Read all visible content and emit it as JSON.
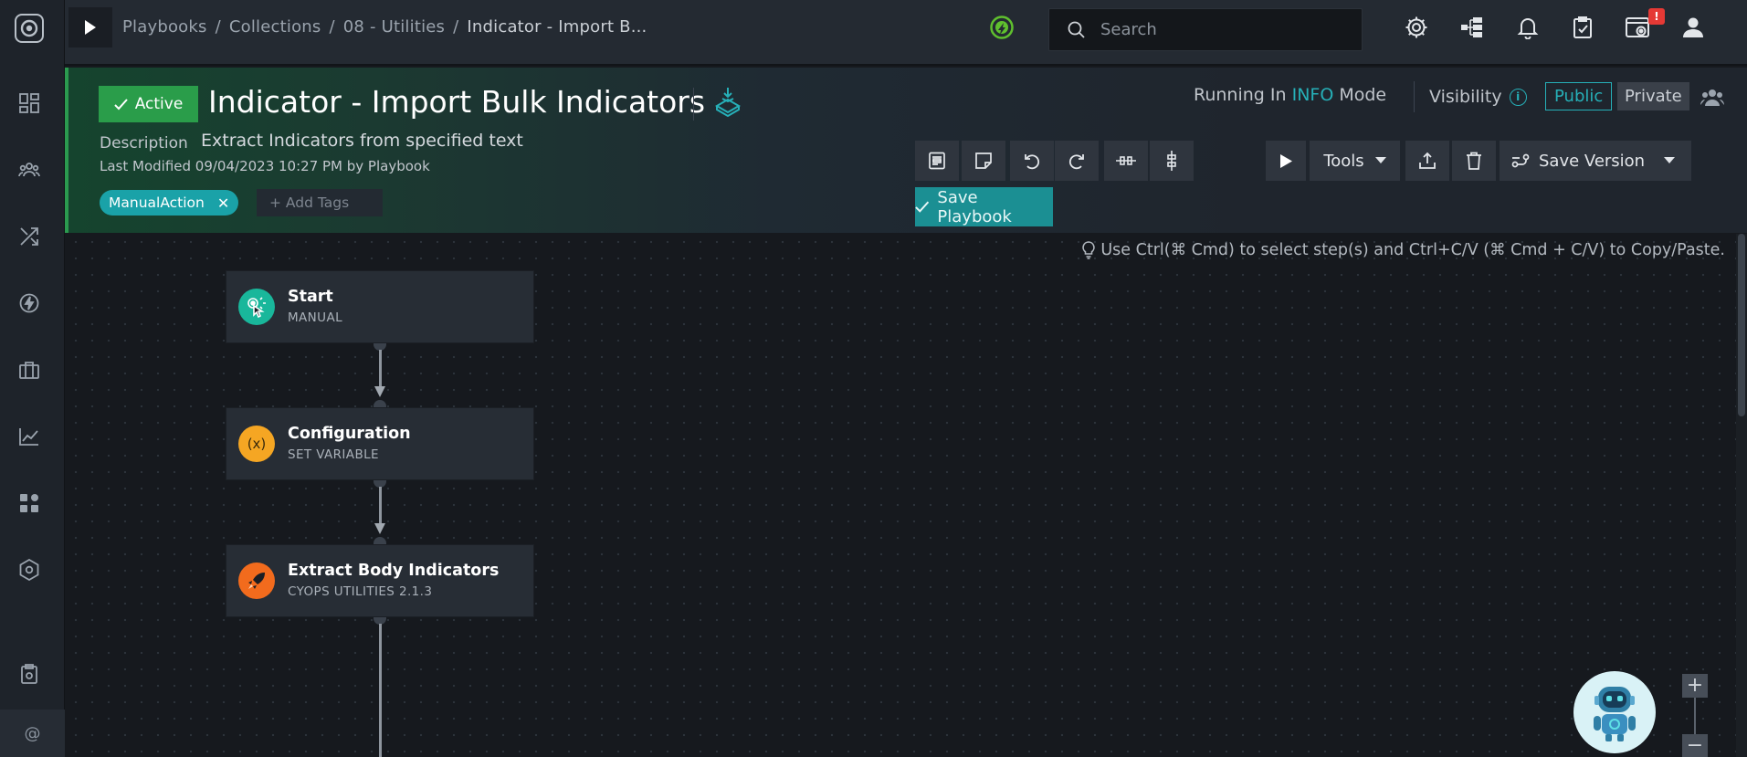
{
  "nav": {
    "breadcrumb": [
      "Playbooks",
      "Collections",
      "08 - Utilities",
      "Indicator - Import B..."
    ],
    "separator": "/"
  },
  "search": {
    "placeholder": "Search"
  },
  "notifications": {
    "badge": "!"
  },
  "sidebar": {
    "items": [
      "dashboard-icon",
      "team-icon",
      "workflow-icon",
      "lightning-icon",
      "briefcase-icon",
      "analytics-icon",
      "apps-icon",
      "hexagon-icon",
      "clipboard-icon"
    ],
    "bottom_label": "@"
  },
  "playbook": {
    "status": "Active",
    "title": "Indicator - Import Bulk Indicators",
    "description_label": "Description",
    "description": "Extract Indicators from specified text",
    "last_modified": "Last Modified 09/04/2023 10:27 PM by Playbook",
    "tags": [
      "ManualAction"
    ],
    "add_tags_placeholder": "+ Add Tags",
    "running_prefix": "Running In",
    "running_mode": "INFO",
    "running_suffix": "Mode",
    "visibility_label": "Visibility",
    "visibility_options": [
      "Public",
      "Private"
    ],
    "visibility_selected": "Public"
  },
  "toolbar": {
    "tools_label": "Tools",
    "save_version_label": "Save Version",
    "save_playbook_label": "Save Playbook"
  },
  "canvas": {
    "hint": "Use Ctrl(⌘ Cmd) to select step(s) and Ctrl+C/V (⌘ Cmd + C/V) to Copy/Paste.",
    "nodes": [
      {
        "title": "Start",
        "subtitle": "MANUAL",
        "icon_color": "#19b79b"
      },
      {
        "title": "Configuration",
        "subtitle": "SET VARIABLE",
        "icon_color": "#f5a623",
        "icon_text": "(x)"
      },
      {
        "title": "Extract Body Indicators",
        "subtitle": "CYOPS UTILITIES 2.1.3",
        "icon_color": "#f26b1d"
      }
    ]
  },
  "zoom": {
    "in": "+",
    "out": "−"
  },
  "colors": {
    "accent_teal": "#26b0b8",
    "active_green": "#2a9d4a",
    "tag_teal": "#1aa2a8",
    "save_playbook": "#1b8f93"
  }
}
